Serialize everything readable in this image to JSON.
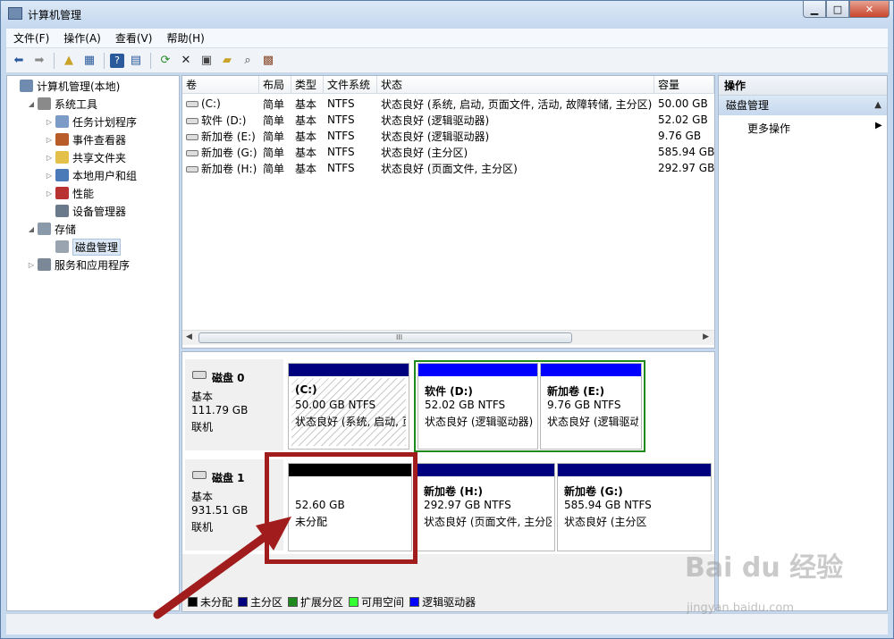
{
  "window": {
    "title": "计算机管理"
  },
  "menu": [
    "文件(F)",
    "操作(A)",
    "查看(V)",
    "帮助(H)"
  ],
  "toolbar": [
    "back-icon",
    "forward-icon",
    "up-icon",
    "show-hide-tree-icon",
    "help-icon",
    "show-hide-action-icon",
    "refresh-icon",
    "delete-icon",
    "properties-icon",
    "open-icon",
    "search-icon",
    "export-icon"
  ],
  "tree": [
    {
      "label": "计算机管理(本地)",
      "level": 0,
      "expander": "",
      "icon": "computer"
    },
    {
      "label": "系统工具",
      "level": 1,
      "expander": "◢",
      "icon": "tools"
    },
    {
      "label": "任务计划程序",
      "level": 2,
      "expander": "▷",
      "icon": "clock"
    },
    {
      "label": "事件查看器",
      "level": 2,
      "expander": "▷",
      "icon": "event"
    },
    {
      "label": "共享文件夹",
      "level": 2,
      "expander": "▷",
      "icon": "folder"
    },
    {
      "label": "本地用户和组",
      "level": 2,
      "expander": "▷",
      "icon": "users"
    },
    {
      "label": "性能",
      "level": 2,
      "expander": "▷",
      "icon": "perf"
    },
    {
      "label": "设备管理器",
      "level": 2,
      "expander": "",
      "icon": "device"
    },
    {
      "label": "存储",
      "level": 1,
      "expander": "◢",
      "icon": "storage"
    },
    {
      "label": "磁盘管理",
      "level": 2,
      "expander": "",
      "icon": "disk",
      "selected": true
    },
    {
      "label": "服务和应用程序",
      "level": 1,
      "expander": "▷",
      "icon": "services"
    }
  ],
  "columns": [
    "卷",
    "布局",
    "类型",
    "文件系统",
    "状态",
    "容量"
  ],
  "volumes": [
    {
      "name": "(C:)",
      "layout": "简单",
      "type": "基本",
      "fs": "NTFS",
      "status": "状态良好 (系统, 启动, 页面文件, 活动, 故障转储, 主分区)",
      "capacity": "50.00 GB"
    },
    {
      "name": "软件 (D:)",
      "layout": "简单",
      "type": "基本",
      "fs": "NTFS",
      "status": "状态良好 (逻辑驱动器)",
      "capacity": "52.02 GB"
    },
    {
      "name": "新加卷 (E:)",
      "layout": "简单",
      "type": "基本",
      "fs": "NTFS",
      "status": "状态良好 (逻辑驱动器)",
      "capacity": "9.76 GB"
    },
    {
      "name": "新加卷 (G:)",
      "layout": "简单",
      "type": "基本",
      "fs": "NTFS",
      "status": "状态良好 (主分区)",
      "capacity": "585.94 GB"
    },
    {
      "name": "新加卷 (H:)",
      "layout": "简单",
      "type": "基本",
      "fs": "NTFS",
      "status": "状态良好 (页面文件, 主分区)",
      "capacity": "292.97 GB"
    }
  ],
  "scroll_grip": "III",
  "disks": [
    {
      "name": "磁盘 0",
      "type": "基本",
      "size": "111.79 GB",
      "state": "联机",
      "partitions": [
        {
          "title": "(C:)",
          "size": "50.00 GB NTFS",
          "status": "状态良好 (系统, 启动, 页",
          "bar": "#00007f",
          "hatched": true
        },
        {
          "title": "软件  (D:)",
          "size": "52.02 GB NTFS",
          "status": "状态良好 (逻辑驱动器)",
          "bar": "#0000ff"
        },
        {
          "title": "新加卷  (E:)",
          "size": "9.76 GB NTFS",
          "status": "状态良好 (逻辑驱动",
          "bar": "#0000ff"
        }
      ]
    },
    {
      "name": "磁盘 1",
      "type": "基本",
      "size": "931.51 GB",
      "state": "联机",
      "partitions": [
        {
          "title": "",
          "size": "52.60 GB",
          "status": "未分配",
          "bar": "#000000"
        },
        {
          "title": "新加卷  (H:)",
          "size": "292.97 GB NTFS",
          "status": "状态良好 (页面文件, 主分区",
          "bar": "#00007f"
        },
        {
          "title": "新加卷  (G:)",
          "size": "585.94 GB NTFS",
          "status": "状态良好 (主分区",
          "bar": "#00007f"
        }
      ]
    }
  ],
  "legend": [
    {
      "label": "未分配",
      "color": "#000000"
    },
    {
      "label": "主分区",
      "color": "#00007f"
    },
    {
      "label": "扩展分区",
      "color": "#1e8a1e"
    },
    {
      "label": "可用空间",
      "color": "#33ff33"
    },
    {
      "label": "逻辑驱动器",
      "color": "#0000ff"
    }
  ],
  "actions": {
    "header": "操作",
    "section": "磁盘管理",
    "item": "更多操作"
  },
  "annotation": {
    "color": "#a11c1c"
  },
  "watermark": {
    "logo": "Bai du 经验",
    "url": "jingyan.baidu.com"
  }
}
